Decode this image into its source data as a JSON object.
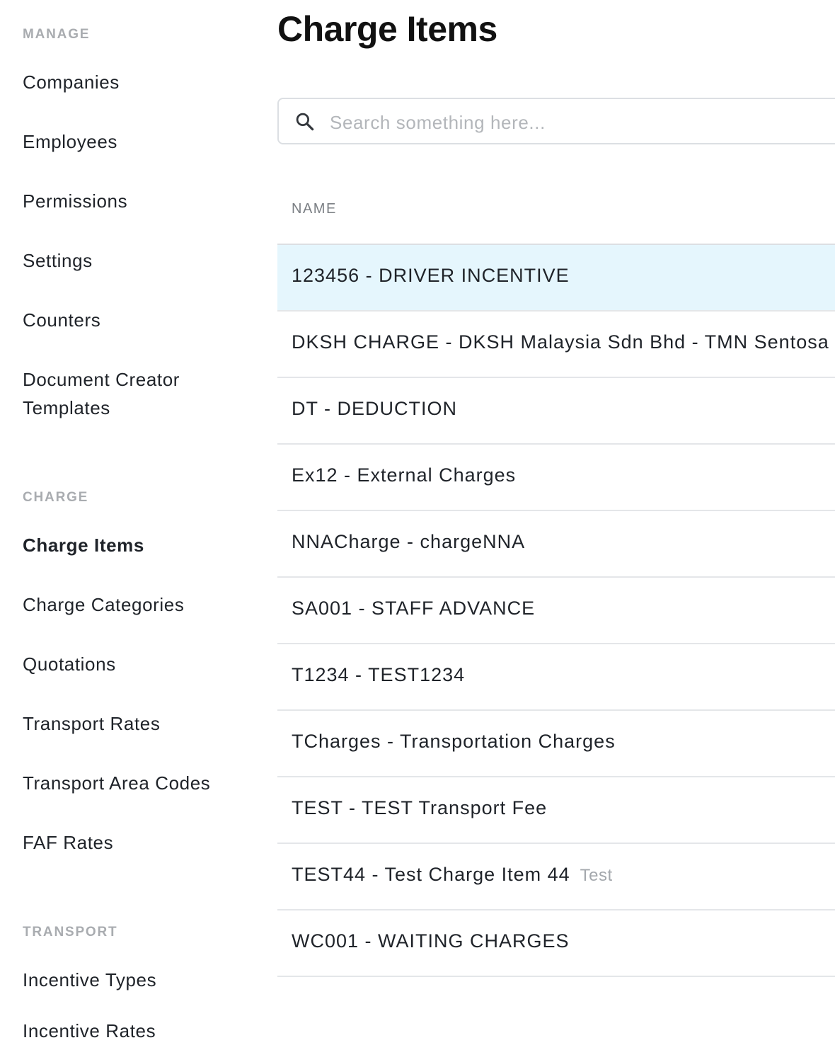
{
  "sidebar": {
    "sections": [
      {
        "label": "MANAGE",
        "items": [
          "Companies",
          "Employees",
          "Permissions",
          "Settings",
          "Counters",
          "Document Creator Templates"
        ]
      },
      {
        "label": "CHARGE",
        "items": [
          "Charge Items",
          "Charge Categories",
          "Quotations",
          "Transport Rates",
          "Transport Area Codes",
          "FAF Rates"
        ]
      },
      {
        "label": "TRANSPORT",
        "items": [
          "Incentive Types",
          "Incentive Rates"
        ]
      }
    ],
    "active_item": "Charge Items"
  },
  "main": {
    "title": "Charge Items",
    "search": {
      "placeholder": "Search something here...",
      "value": ""
    },
    "table": {
      "column_header": "NAME",
      "rows": [
        {
          "name": "123456 - DRIVER INCENTIVE",
          "tag": "",
          "selected": true
        },
        {
          "name": "DKSH CHARGE - DKSH Malaysia Sdn Bhd - TMN Sentosa",
          "tag": ""
        },
        {
          "name": "DT - DEDUCTION",
          "tag": ""
        },
        {
          "name": "Ex12 - External Charges",
          "tag": ""
        },
        {
          "name": "NNACharge - chargeNNA",
          "tag": ""
        },
        {
          "name": "SA001 - STAFF ADVANCE",
          "tag": ""
        },
        {
          "name": "T1234 - TEST1234",
          "tag": ""
        },
        {
          "name": "TCharges - Transportation Charges",
          "tag": ""
        },
        {
          "name": "TEST - TEST Transport Fee",
          "tag": ""
        },
        {
          "name": "TEST44 - Test Charge Item 44",
          "tag": "Test"
        },
        {
          "name": "WC001 - WAITING CHARGES",
          "tag": ""
        }
      ]
    }
  }
}
